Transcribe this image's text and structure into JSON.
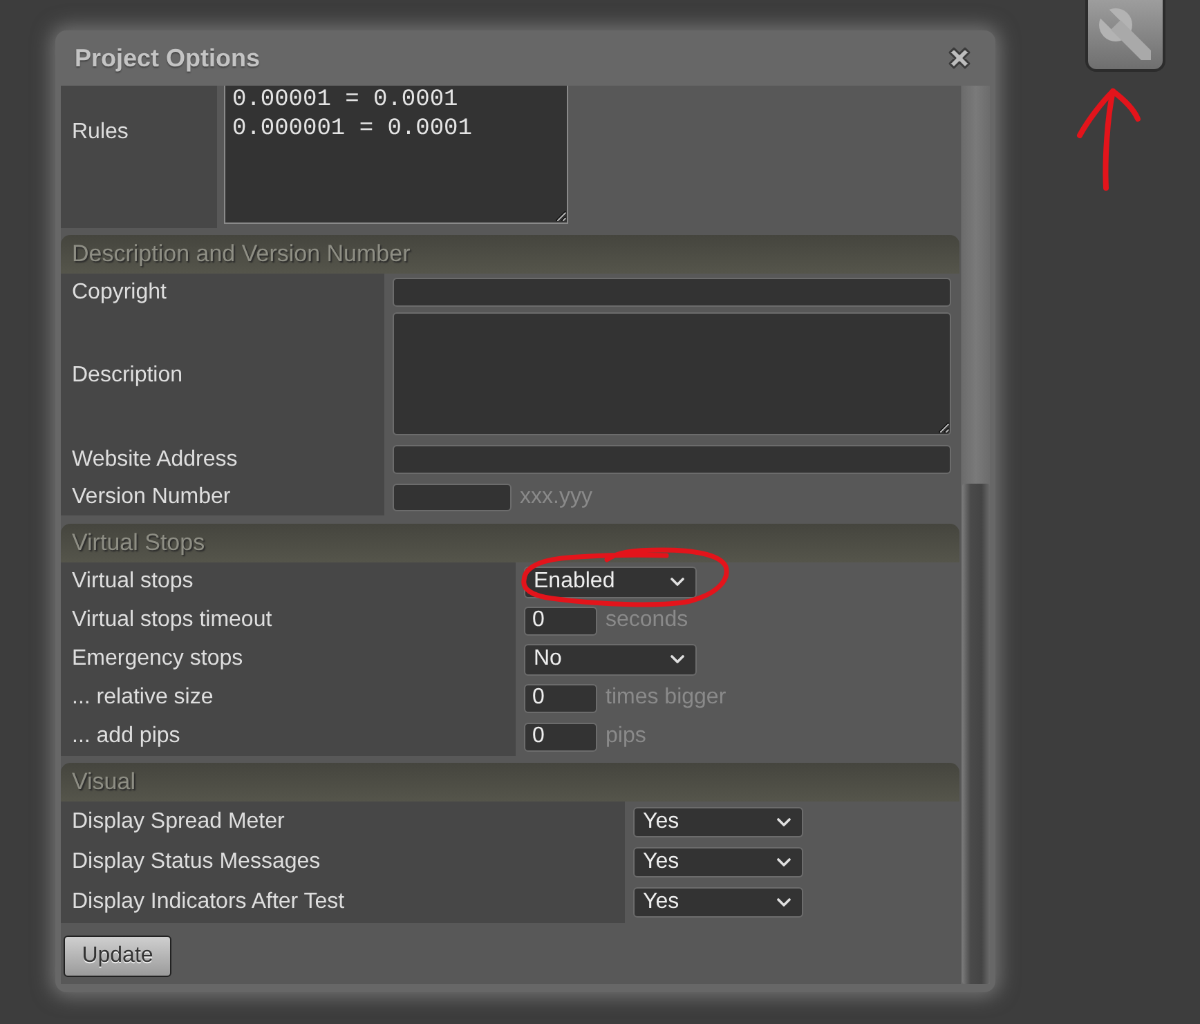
{
  "window": {
    "title": "Project Options"
  },
  "rules": {
    "label": "Rules",
    "lines": [
      "0.00001 = 0.0001",
      "0.000001 = 0.0001"
    ]
  },
  "sections": [
    {
      "title": "Description and Version Number",
      "rows": [
        {
          "label": "Copyright",
          "kind": "text",
          "circled": false
        },
        {
          "label": "Description",
          "kind": "textarea",
          "circled": false
        },
        {
          "label": "Website Address",
          "kind": "text",
          "circled": false
        },
        {
          "label": "Version Number",
          "kind": "short_text",
          "suffix": "xxx.yyy",
          "circled": false
        }
      ]
    },
    {
      "title": "Virtual Stops",
      "rows": [
        {
          "label": "Virtual stops",
          "kind": "select",
          "value": "Enabled",
          "circled": true
        },
        {
          "label": "Virtual stops timeout",
          "kind": "number",
          "value": "0",
          "suffix": "seconds",
          "circled": false
        },
        {
          "label": "Emergency stops",
          "kind": "select",
          "value": "No",
          "circled": false
        },
        {
          "label": "... relative size",
          "kind": "number",
          "value": "0",
          "suffix": "times bigger",
          "circled": false
        },
        {
          "label": "... add pips",
          "kind": "number",
          "value": "0",
          "suffix": "pips",
          "circled": false
        }
      ]
    },
    {
      "title": "Visual",
      "rows": [
        {
          "label": "Display Spread Meter",
          "kind": "select",
          "value": "Yes",
          "circled": false
        },
        {
          "label": "Display Status Messages",
          "kind": "select",
          "value": "Yes",
          "circled": false
        },
        {
          "label": "Display Indicators After Test",
          "kind": "select",
          "value": "Yes",
          "circled": false
        }
      ]
    }
  ],
  "update_button": {
    "label": "Update"
  },
  "tool_button": {
    "arrow_drawn": true
  }
}
